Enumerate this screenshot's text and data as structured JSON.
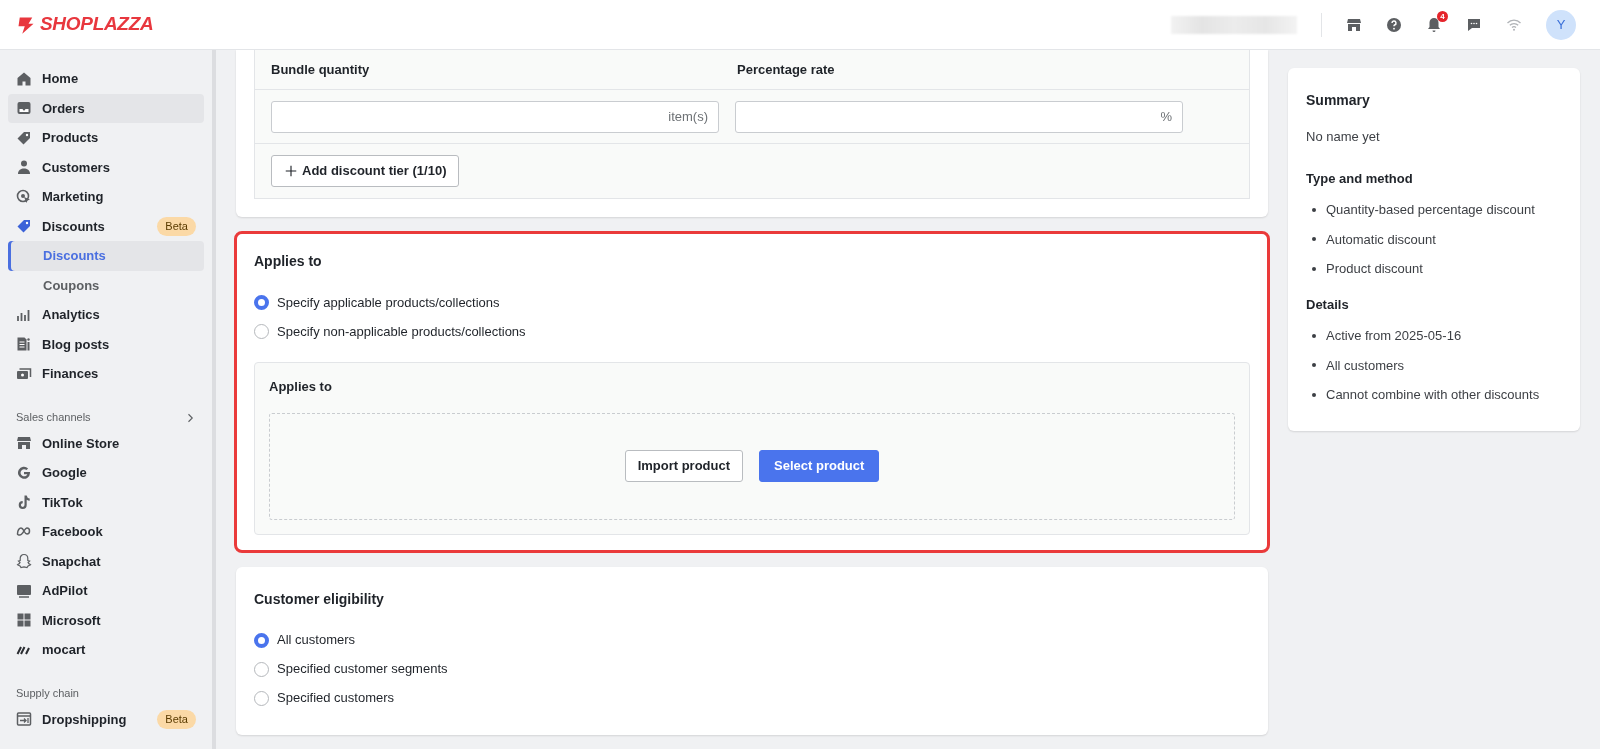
{
  "header": {
    "logo": "SHOPLAZZA",
    "notification_count": "4",
    "avatar": "Y"
  },
  "sidebar": {
    "sections": [
      {
        "items": [
          {
            "label": "Home",
            "selected": false,
            "hovered": false
          },
          {
            "label": "Orders",
            "selected": false,
            "hovered": true
          },
          {
            "label": "Products",
            "selected": false,
            "hovered": false
          },
          {
            "label": "Customers",
            "selected": false,
            "hovered": false
          },
          {
            "label": "Marketing",
            "selected": false,
            "hovered": false
          },
          {
            "label": "Discounts",
            "hovered": false,
            "badge": "Beta",
            "children": [
              {
                "label": "Discounts",
                "selected": true
              },
              {
                "label": "Coupons",
                "selected": false
              }
            ]
          },
          {
            "label": "Analytics",
            "selected": false,
            "hovered": false
          },
          {
            "label": "Blog posts",
            "selected": false,
            "hovered": false
          },
          {
            "label": "Finances",
            "selected": false,
            "hovered": false
          }
        ]
      },
      {
        "heading": "Sales channels",
        "items": [
          {
            "label": "Online Store",
            "selected": false,
            "hovered": false
          },
          {
            "label": "Google",
            "selected": false,
            "hovered": false
          },
          {
            "label": "TikTok",
            "selected": false,
            "hovered": false
          },
          {
            "label": "Facebook",
            "selected": false,
            "hovered": false
          },
          {
            "label": "Snapchat",
            "selected": false,
            "hovered": false
          },
          {
            "label": "AdPilot",
            "selected": false,
            "hovered": false
          },
          {
            "label": "Microsoft",
            "selected": false,
            "hovered": false
          },
          {
            "label": "mocart",
            "selected": false,
            "hovered": false
          }
        ]
      },
      {
        "heading": "Supply chain",
        "items": [
          {
            "label": "Dropshipping",
            "selected": false,
            "hovered": false,
            "badge": "Beta"
          }
        ]
      }
    ]
  },
  "tiers": {
    "columns": [
      "Bundle quantity",
      "Percentage rate"
    ],
    "fields": [
      {
        "suffix": "item(s)"
      },
      {
        "suffix": "%"
      }
    ],
    "add_button": "Add discount tier (1/10)"
  },
  "applies_to": {
    "title": "Applies to",
    "highlighted": true,
    "options": [
      {
        "label": "Specify applicable products/collections",
        "selected": true
      },
      {
        "label": "Specify non-applicable products/collections",
        "selected": false
      }
    ],
    "panel": {
      "title": "Applies to",
      "buttons": [
        {
          "label": "Import product",
          "kind": "secondary"
        },
        {
          "label": "Select product",
          "kind": "primary"
        }
      ]
    }
  },
  "customer_eligibility": {
    "title": "Customer eligibility",
    "highlighted": false,
    "options": [
      {
        "label": "All customers",
        "selected": true
      },
      {
        "label": "Specified customer segments",
        "selected": false
      },
      {
        "label": "Specified customers",
        "selected": false
      }
    ]
  },
  "summary": {
    "title": "Summary",
    "name": "No name yet",
    "sections": [
      {
        "heading": "Type and method",
        "items": [
          "Quantity-based percentage discount",
          "Automatic discount",
          "Product discount"
        ]
      },
      {
        "heading": "Details",
        "items": [
          "Active from 2025-05-16",
          "All customers",
          "Cannot combine with other discounts"
        ]
      }
    ]
  }
}
